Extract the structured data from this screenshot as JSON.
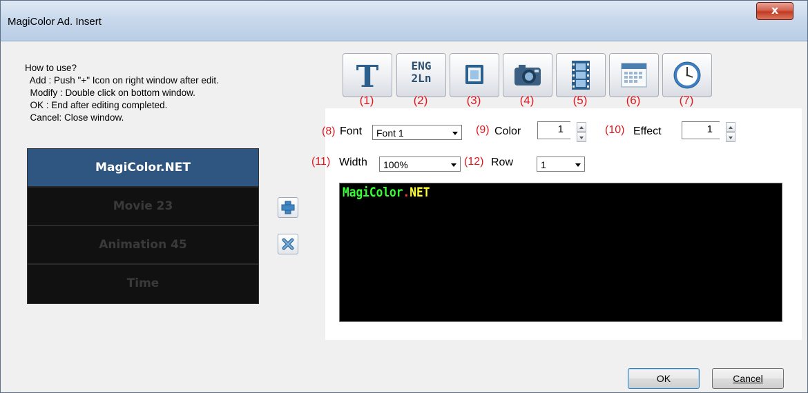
{
  "window": {
    "title": "MagiColor Ad. Insert",
    "close_label": "x"
  },
  "help": {
    "lines": [
      "How to use?",
      "  Add : Push \"+\" Icon on right window after edit.",
      "  Modify : Double click on bottom window.",
      "  OK : End after editing completed.",
      "  Cancel: Close window."
    ]
  },
  "list": {
    "items": [
      "MagiColor.NET",
      "Movie 23",
      "Animation 45",
      "Time"
    ],
    "selected_index": 0
  },
  "toolbar": {
    "buttons": [
      {
        "icon": "text-T-icon",
        "num": "(1)"
      },
      {
        "icon": "eng-2ln-icon",
        "label_top": "ENG",
        "label_bottom": "2Ln",
        "num": "(2)"
      },
      {
        "icon": "picture-icon",
        "num": "(3)"
      },
      {
        "icon": "camera-icon",
        "num": "(4)"
      },
      {
        "icon": "film-icon",
        "num": "(5)"
      },
      {
        "icon": "calendar-icon",
        "num": "(6)"
      },
      {
        "icon": "clock-icon",
        "num": "(7)"
      }
    ]
  },
  "settings": {
    "font": {
      "num": "(8)",
      "label": "Font",
      "value": "Font 1"
    },
    "color": {
      "num": "(9)",
      "label": "Color",
      "value": "1"
    },
    "effect": {
      "num": "(10)",
      "label": "Effect",
      "value": "1"
    },
    "width": {
      "num": "(11)",
      "label": "Width",
      "value": "100%"
    },
    "row": {
      "num": "(12)",
      "label": "Row",
      "value": "1"
    }
  },
  "preview": {
    "part1": "MagiColor",
    "part2": ".",
    "part3": "NET",
    "colors": {
      "part1": "#33ff33",
      "part2": "#ff3333",
      "part3": "#ffff33",
      "background": "#000000"
    }
  },
  "buttons": {
    "ok": "OK",
    "cancel": "Cancel"
  },
  "colors": {
    "number_red": "#e0191f",
    "selected_row": "#2e5680"
  }
}
